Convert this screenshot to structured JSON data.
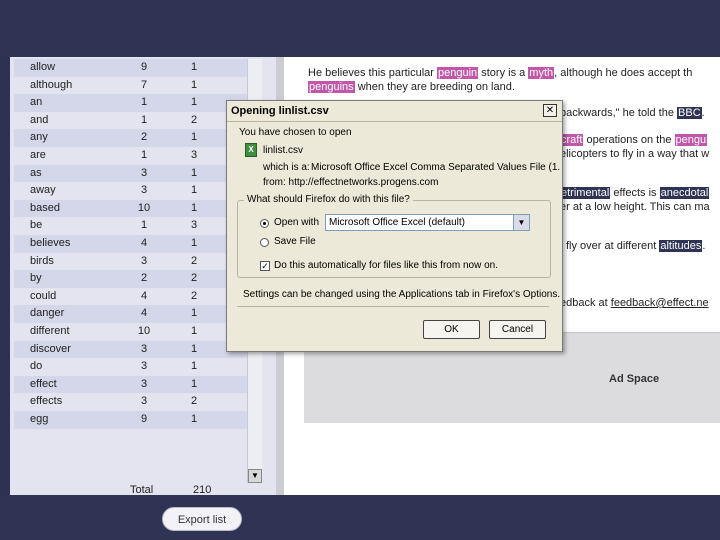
{
  "wordlist": {
    "rows": [
      {
        "word": "allow",
        "count": "9",
        "files": "1"
      },
      {
        "word": "although",
        "count": "7",
        "files": "1"
      },
      {
        "word": "an",
        "count": "1",
        "files": "1"
      },
      {
        "word": "and",
        "count": "1",
        "files": "2"
      },
      {
        "word": "any",
        "count": "2",
        "files": "1"
      },
      {
        "word": "are",
        "count": "1",
        "files": "3"
      },
      {
        "word": "as",
        "count": "3",
        "files": "1"
      },
      {
        "word": "away",
        "count": "3",
        "files": "1"
      },
      {
        "word": "based",
        "count": "10",
        "files": "1"
      },
      {
        "word": "be",
        "count": "1",
        "files": "3"
      },
      {
        "word": "believes",
        "count": "4",
        "files": "1"
      },
      {
        "word": "birds",
        "count": "3",
        "files": "2"
      },
      {
        "word": "by",
        "count": "2",
        "files": "2"
      },
      {
        "word": "could",
        "count": "4",
        "files": "2"
      },
      {
        "word": "danger",
        "count": "4",
        "files": "1"
      },
      {
        "word": "different",
        "count": "10",
        "files": "1"
      },
      {
        "word": "discover",
        "count": "3",
        "files": "1"
      },
      {
        "word": "do",
        "count": "3",
        "files": "1"
      },
      {
        "word": "effect",
        "count": "3",
        "files": "1"
      },
      {
        "word": "effects",
        "count": "3",
        "files": "2"
      },
      {
        "word": "egg",
        "count": "9",
        "files": "1"
      }
    ],
    "total_label": "Total",
    "total_value": "210",
    "export_label": "Export list"
  },
  "article": {
    "l1_a": "He believes this particular ",
    "l1_h1": "penguin",
    "l1_b": " story is a ",
    "l1_h2": "myth",
    "l1_c": ", although he does accept th",
    "l2_h": "penguins",
    "l2_a": " when they are breeding on land.",
    "l3_a": "backwards,\" he told the ",
    "l3_h": "BBC",
    "l3_b": ".",
    "l4_h1": "craft",
    "l4_a": " operations on the ",
    "l4_h2": "pengu",
    "l5_a": "elicopters to fly in a way that w",
    "l6_h1": "etrimental",
    "l6_a": " effects is ",
    "l6_h2": "anecdotal",
    "l7_a": "er at a low height. This can ma",
    "l8_a": "fly over at different ",
    "l8_h": "altitudes",
    "l8_b": ".",
    "l9_a": "edback at ",
    "l9_link": "feedback@effect.ne",
    "ad_label": "Ad Space"
  },
  "dialog": {
    "title": "Opening linlist.csv",
    "close_glyph": "✕",
    "intro": "You have chosen to open",
    "filename": "linlist.csv",
    "which_is_label": "which is a:",
    "which_is_value": "Microsoft Office Excel Comma Separated Values File (1.",
    "from": "from: http://effectnetworks.progens.com",
    "group_label": "What should Firefox do with this file?",
    "open_with_label": "Open with",
    "open_with_value": "Microsoft Office Excel (default)",
    "save_file_label": "Save File",
    "auto_label": "Do this automatically for files like this from now on.",
    "settings_note": "Settings can be changed using the Applications tab in Firefox's Options.",
    "ok_label": "OK",
    "cancel_label": "Cancel",
    "file_icon": "excel-file-icon"
  }
}
